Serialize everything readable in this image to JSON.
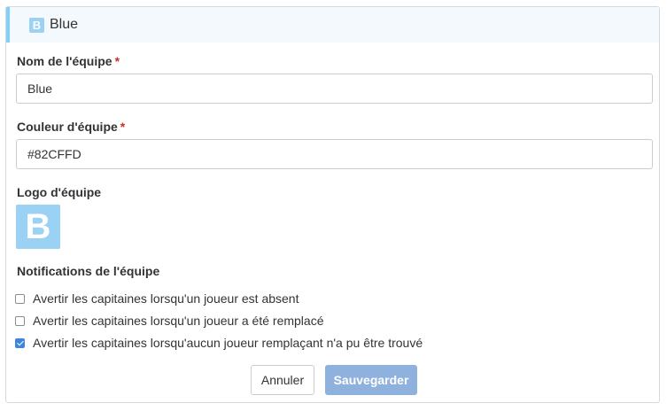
{
  "header": {
    "logo_letter": "B",
    "title": "Blue"
  },
  "form": {
    "team_name": {
      "label": "Nom de l'équipe",
      "required_mark": "*",
      "value": "Blue"
    },
    "team_color": {
      "label": "Couleur d'équipe",
      "required_mark": "*",
      "value": "#82CFFD"
    },
    "team_logo": {
      "label": "Logo d'équipe",
      "letter": "B"
    },
    "notifications": {
      "label": "Notifications de l'équipe",
      "items": [
        {
          "label": "Avertir les capitaines lorsqu'un joueur est absent",
          "checked": false
        },
        {
          "label": "Avertir les capitaines lorsqu'un joueur a été remplacé",
          "checked": false
        },
        {
          "label": "Avertir les capitaines lorsqu'aucun joueur remplaçant n'a pu être trouvé",
          "checked": true
        }
      ]
    }
  },
  "actions": {
    "cancel_label": "Annuler",
    "save_label": "Sauvegarder"
  },
  "colors": {
    "team_color": "#82CFFD",
    "logo_background": "#9BD1F3",
    "primary_disabled": "#8FB1DD",
    "required": "#C9302C"
  }
}
